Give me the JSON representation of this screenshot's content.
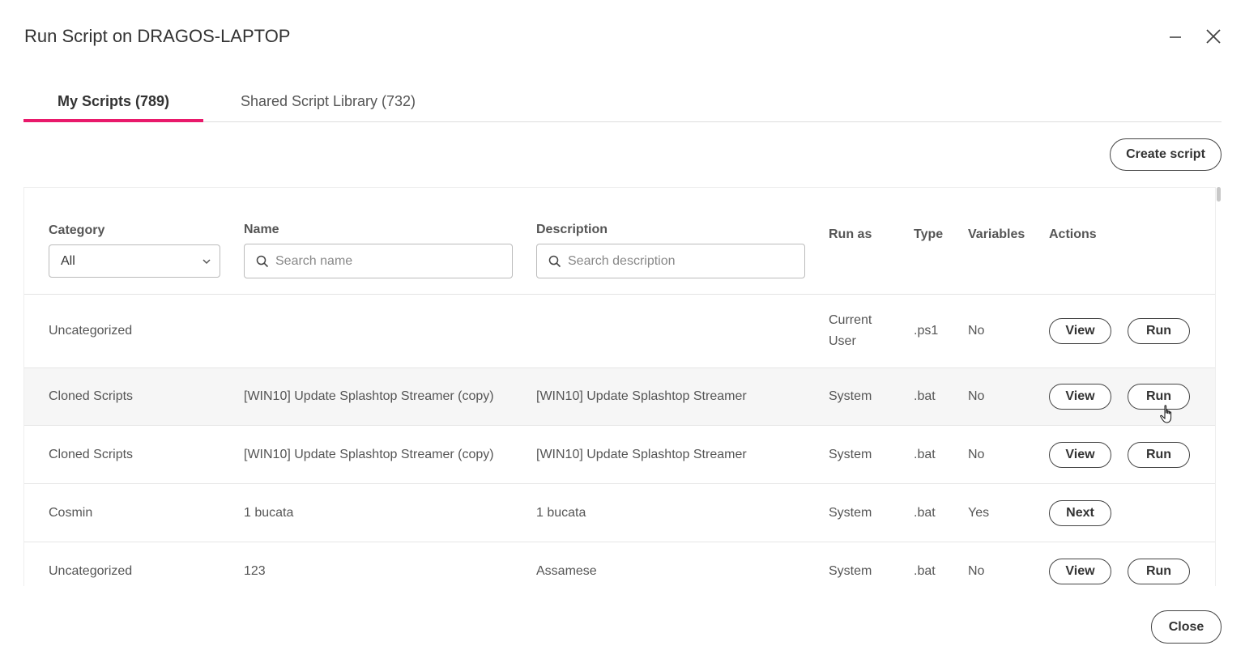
{
  "dialog": {
    "title": "Run Script on DRAGOS-LAPTOP"
  },
  "tabs": [
    {
      "label": "My Scripts (789)",
      "active": true
    },
    {
      "label": "Shared Script Library (732)",
      "active": false
    }
  ],
  "toolbar": {
    "create_label": "Create script"
  },
  "filters": {
    "category_label": "Category",
    "category_value": "All",
    "name_label": "Name",
    "name_placeholder": "Search name",
    "description_label": "Description",
    "description_placeholder": "Search description"
  },
  "columns": {
    "runas": "Run as",
    "type": "Type",
    "variables": "Variables",
    "actions": "Actions"
  },
  "rows": [
    {
      "category": "Uncategorized",
      "name": "",
      "description": "",
      "runas": "Current User",
      "type": ".ps1",
      "variables": "No",
      "actions": [
        "View",
        "Run"
      ]
    },
    {
      "category": "Cloned Scripts",
      "name": "[WIN10] Update Splashtop Streamer (copy)",
      "description": "[WIN10] Update Splashtop Streamer",
      "runas": "System",
      "type": ".bat",
      "variables": "No",
      "actions": [
        "View",
        "Run"
      ]
    },
    {
      "category": "Cloned Scripts",
      "name": "[WIN10] Update Splashtop Streamer (copy)",
      "description": "[WIN10] Update Splashtop Streamer",
      "runas": "System",
      "type": ".bat",
      "variables": "No",
      "actions": [
        "View",
        "Run"
      ]
    },
    {
      "category": "Cosmin",
      "name": "1 bucata",
      "description": "1 bucata",
      "runas": "System",
      "type": ".bat",
      "variables": "Yes",
      "actions": [
        "Next"
      ]
    },
    {
      "category": "Uncategorized",
      "name": "123",
      "description": "Assamese",
      "runas": "System",
      "type": ".bat",
      "variables": "No",
      "actions": [
        "View",
        "Run"
      ]
    }
  ],
  "footer": {
    "close_label": "Close"
  },
  "colors": {
    "accent": "#e9196b"
  }
}
